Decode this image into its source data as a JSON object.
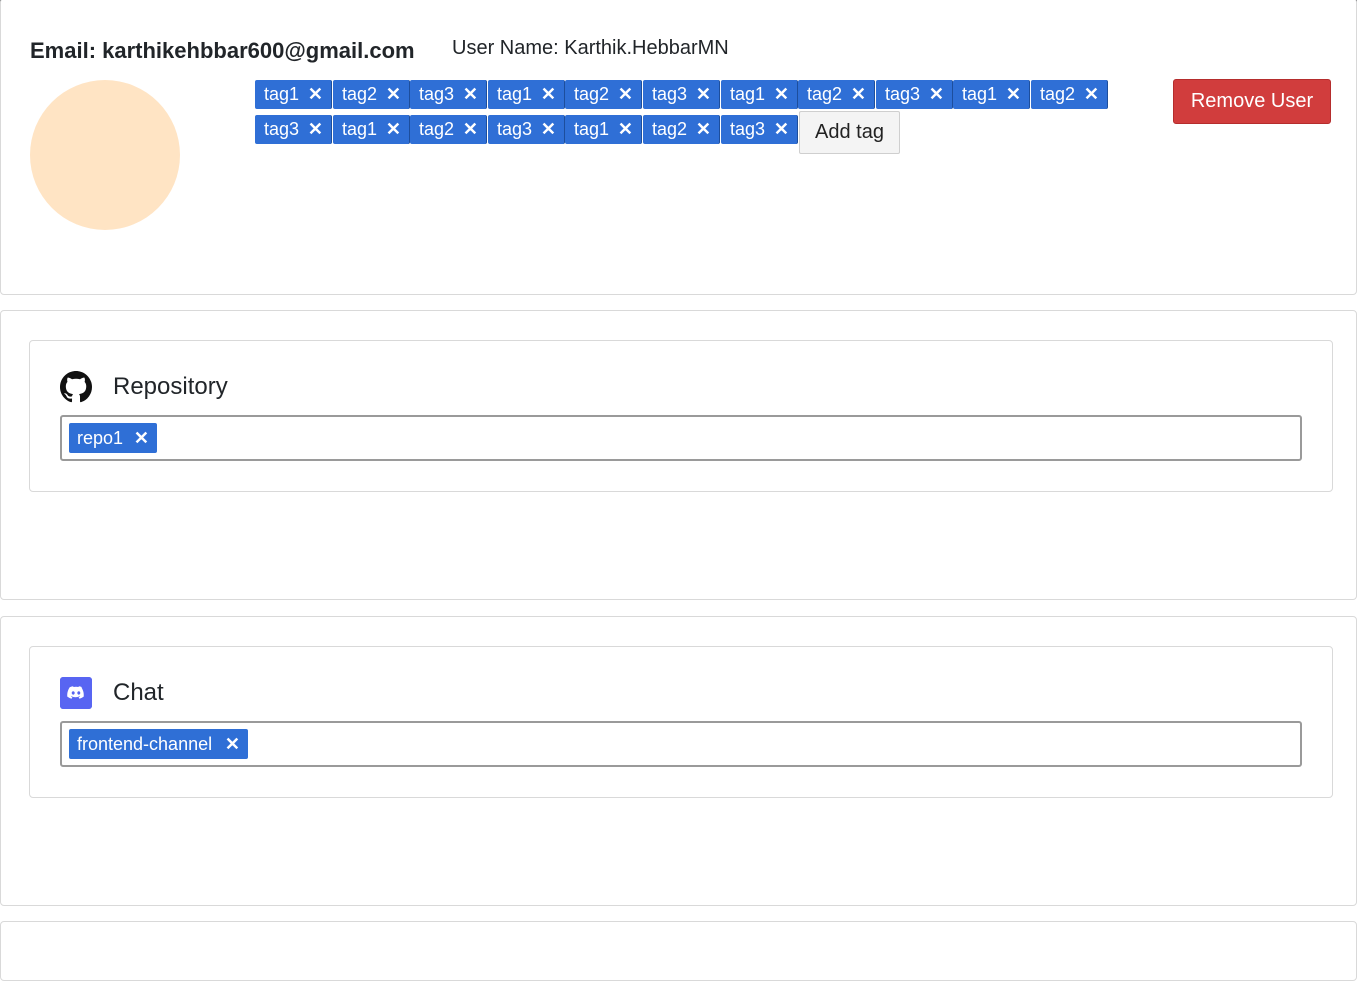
{
  "user": {
    "email_label": "Email: karthikehbbar600@gmail.com",
    "username_label": "User Name: Karthik.HebbarMN",
    "remove_button": "Remove User",
    "add_tag_button": "Add tag",
    "tag_remove_glyph": "✕",
    "tags": [
      "tag1",
      "tag2",
      "tag3",
      "tag1",
      "tag2",
      "tag3",
      "tag1",
      "tag2",
      "tag3",
      "tag1",
      "tag2",
      "tag3",
      "tag1",
      "tag2",
      "tag3",
      "tag1",
      "tag2",
      "tag3"
    ]
  },
  "repository": {
    "title": "Repository",
    "icon": "github-icon",
    "items": [
      "repo1"
    ]
  },
  "chat": {
    "title": "Chat",
    "icon": "discord-icon",
    "items": [
      "frontend-channel"
    ]
  },
  "colors": {
    "tag_bg": "#2f6fd6",
    "danger": "#d13d3d",
    "avatar": "#ffe4c4",
    "discord": "#5865f2"
  }
}
